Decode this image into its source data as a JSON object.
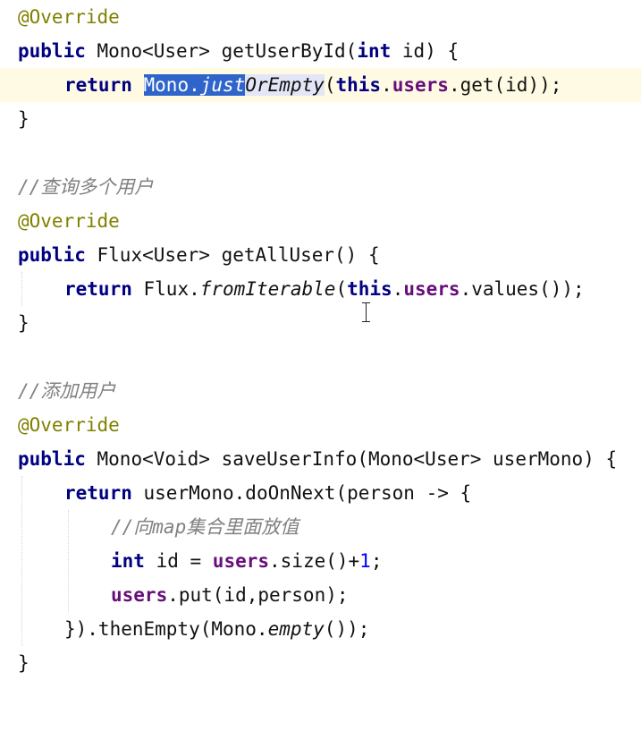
{
  "editor": {
    "annotation": "@Override",
    "comment_query_all": "//查询多个用户",
    "comment_add": "//添加用户",
    "comment_put_map": "//向map集合里面放值",
    "kw_public": "public",
    "kw_return": "return",
    "kw_this": "this",
    "kw_int": "int",
    "m1_type": "Mono<User>",
    "m1_name": "getUserById(",
    "m1_param_name": " id) {",
    "m1_sel": "Mono.",
    "m1_sel_italic": "just",
    "m1_hl_italic": "OrEmpty",
    "m1_tail": "(",
    "field_users": "users",
    "m1_tail2": ".get(id));",
    "close_brace": "}",
    "m2_type": "Flux<User>",
    "m2_name": "getAllUser() {",
    "m2_flux": "Flux.",
    "m2_from": "fromIterable",
    "m2_open": "(",
    "m2_tail": ".values());",
    "m3_type": "Mono<Void>",
    "m3_sig": "saveUserInfo(Mono<User> userMono) {",
    "m3_ret": "userMono.doOnNext(person -> {",
    "m3_int_id": " id = ",
    "m3_size": ".size()+",
    "m3_one": "1",
    "m3_semi": ";",
    "m3_put": ".put(id,person);",
    "m3_then": "}).thenEmpty(Mono.",
    "m3_empty": "empty",
    "m3_end": "());"
  }
}
